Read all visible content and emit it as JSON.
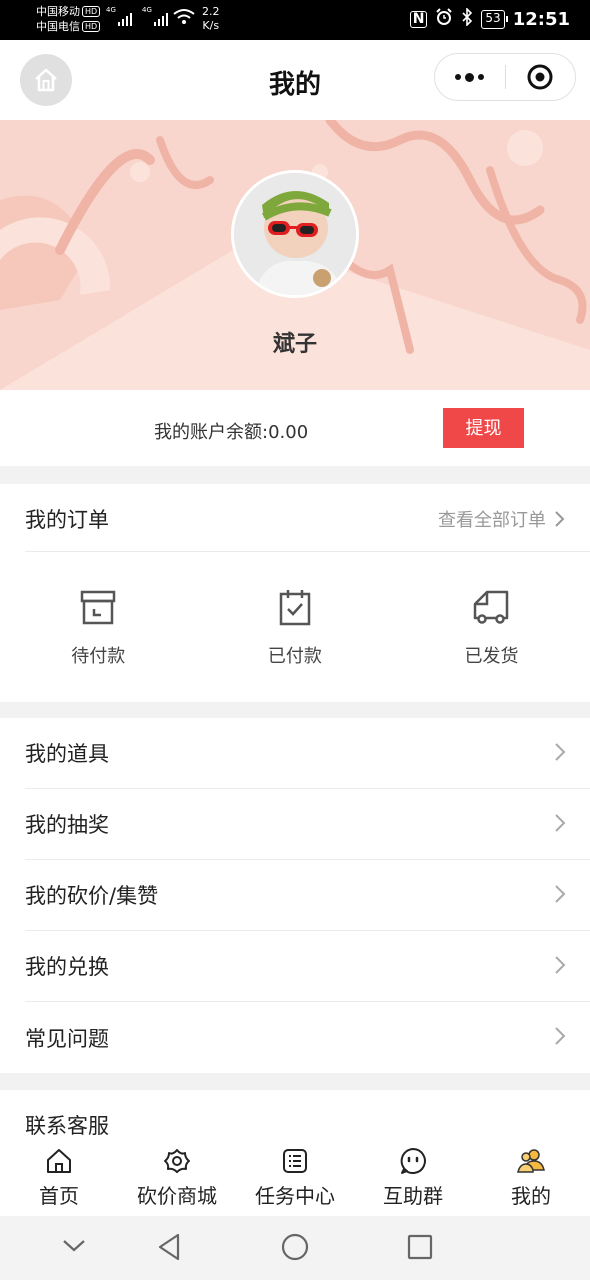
{
  "status_bar": {
    "carrier_1": "中国移动",
    "carrier_2": "中国电信",
    "hd": "HD",
    "net_tag": "4G",
    "speed_value": "2.2",
    "speed_unit": "K/s",
    "battery": "53",
    "time": "12:51"
  },
  "navbar": {
    "title": "我的"
  },
  "profile": {
    "username": "斌子"
  },
  "balance": {
    "text": "我的账户余额:0.00",
    "withdraw_label": "提现"
  },
  "orders": {
    "title": "我的订单",
    "view_all": "查看全部订单",
    "items": [
      {
        "label": "待付款",
        "icon": "archive-box-icon"
      },
      {
        "label": "已付款",
        "icon": "calendar-check-icon"
      },
      {
        "label": "已发货",
        "icon": "delivery-truck-icon"
      }
    ]
  },
  "menu": {
    "items": [
      {
        "label": "我的道具"
      },
      {
        "label": "我的抽奖"
      },
      {
        "label": "我的砍价/集赞"
      },
      {
        "label": "我的兑换"
      },
      {
        "label": "常见问题"
      }
    ]
  },
  "service": {
    "label": "联系客服"
  },
  "tabbar": {
    "items": [
      {
        "label": "首页",
        "icon": "home-icon"
      },
      {
        "label": "砍价商城",
        "icon": "flower-icon"
      },
      {
        "label": "任务中心",
        "icon": "task-list-icon"
      },
      {
        "label": "互助群",
        "icon": "chat-face-icon"
      },
      {
        "label": "我的",
        "icon": "users-icon",
        "active": true
      }
    ]
  },
  "colors": {
    "banner_bg": "#f9d6cd",
    "withdraw_bg": "#f04848",
    "active_tab": "#f5b941"
  }
}
